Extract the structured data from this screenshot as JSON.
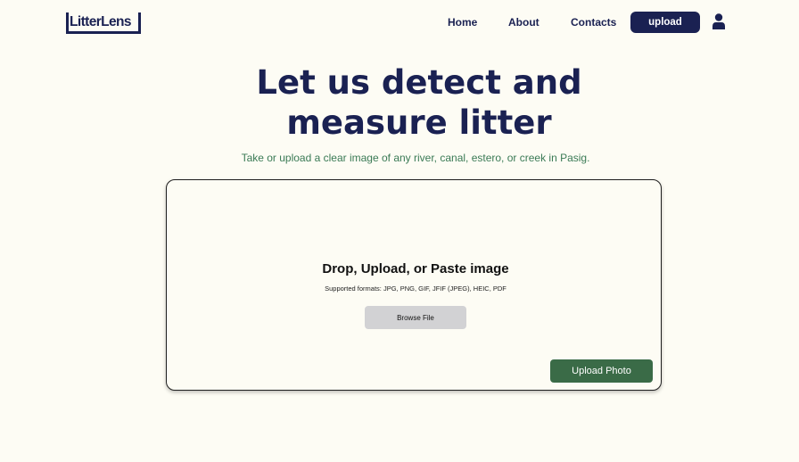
{
  "header": {
    "logo_text": "LitterLens",
    "nav": {
      "home": "Home",
      "about": "About",
      "contacts": "Contacts",
      "upload": "upload"
    },
    "user_icon": "user-icon"
  },
  "hero": {
    "title_line1": "Let us detect and",
    "title_line2": "measure litter",
    "subtitle": "Take or upload a clear image of any river, canal, estero, or creek in Pasig."
  },
  "upload_card": {
    "drop_title": "Drop, Upload, or Paste image",
    "supported_formats": "Supported formats: JPG, PNG, GIF, JFIF (JPEG), HEIC, PDF",
    "browse_label": "Browse File",
    "upload_photo_label": "Upload Photo"
  },
  "colors": {
    "background": "#fdfcf4",
    "navy": "#1a2152",
    "green_text": "#3a7a55",
    "green_button": "#3a6b47",
    "gray_button": "#d2d2d4"
  }
}
